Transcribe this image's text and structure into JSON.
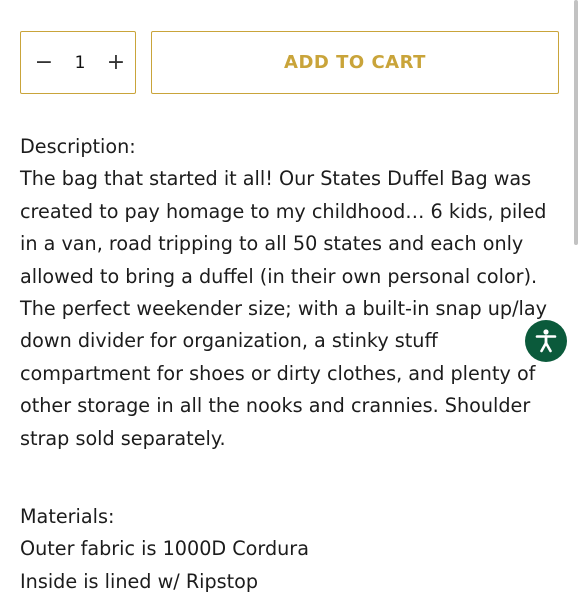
{
  "quantity": {
    "decrement_symbol": "−",
    "value": "1",
    "increment_symbol": "+"
  },
  "add_to_cart": {
    "label": "ADD TO CART"
  },
  "description": {
    "heading": "Description:",
    "body": "The bag that started it all! Our States Duffel Bag was created to pay homage to my childhood… 6 kids, piled in a van, road tripping to all 50 states and each only allowed to bring a duffel (in their own personal color). The perfect weekender size; with a built-in snap up/lay down divider for organization, a stinky stuff compartment for shoes or dirty clothes, and plenty of other storage in all the nooks and crannies. Shoulder strap sold separately."
  },
  "materials": {
    "heading": "Materials:",
    "items": [
      "Outer fabric is 1000D Cordura",
      "Inside is lined w/ Ripstop"
    ]
  },
  "accessibility": {
    "icon": "accessibility-icon"
  },
  "colors": {
    "accent": "#c9a43a",
    "accessibility_bg": "#0b5a3b"
  }
}
